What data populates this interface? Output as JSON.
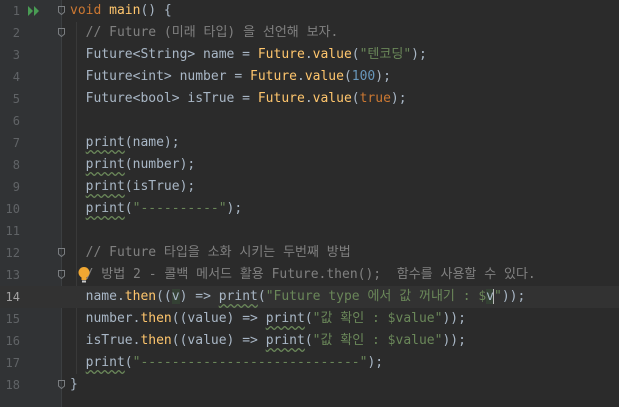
{
  "editor": {
    "lines": [
      {
        "n": "1",
        "tokens": [
          {
            "t": "void",
            "c": "kw"
          },
          {
            "t": " "
          },
          {
            "t": "main",
            "c": "fn"
          },
          {
            "t": "() {"
          }
        ]
      },
      {
        "n": "2",
        "tokens": [
          {
            "t": "  "
          },
          {
            "t": "// Future (미래 타입) 을 선언해 보자.",
            "c": "cmt"
          }
        ]
      },
      {
        "n": "3",
        "tokens": [
          {
            "t": "  Future<String> name = "
          },
          {
            "t": "Future",
            "c": "fn"
          },
          {
            "t": "."
          },
          {
            "t": "value",
            "c": "fn"
          },
          {
            "t": "("
          },
          {
            "t": "\"텐코딩\"",
            "c": "str"
          },
          {
            "t": ");"
          }
        ]
      },
      {
        "n": "4",
        "tokens": [
          {
            "t": "  Future<int> number = "
          },
          {
            "t": "Future",
            "c": "fn"
          },
          {
            "t": "."
          },
          {
            "t": "value",
            "c": "fn"
          },
          {
            "t": "("
          },
          {
            "t": "100",
            "c": "num"
          },
          {
            "t": ");"
          }
        ]
      },
      {
        "n": "5",
        "tokens": [
          {
            "t": "  Future<bool> isTrue = "
          },
          {
            "t": "Future",
            "c": "fn"
          },
          {
            "t": "."
          },
          {
            "t": "value",
            "c": "fn"
          },
          {
            "t": "("
          },
          {
            "t": "true",
            "c": "kw"
          },
          {
            "t": ");"
          }
        ]
      },
      {
        "n": "6",
        "tokens": []
      },
      {
        "n": "7",
        "tokens": [
          {
            "t": "  "
          },
          {
            "t": "print",
            "c": "warn"
          },
          {
            "t": "(name);"
          }
        ]
      },
      {
        "n": "8",
        "tokens": [
          {
            "t": "  "
          },
          {
            "t": "print",
            "c": "warn"
          },
          {
            "t": "(number);"
          }
        ]
      },
      {
        "n": "9",
        "tokens": [
          {
            "t": "  "
          },
          {
            "t": "print",
            "c": "warn"
          },
          {
            "t": "(isTrue);"
          }
        ]
      },
      {
        "n": "10",
        "tokens": [
          {
            "t": "  "
          },
          {
            "t": "print",
            "c": "warn"
          },
          {
            "t": "("
          },
          {
            "t": "\"----------\"",
            "c": "str"
          },
          {
            "t": ");"
          }
        ]
      },
      {
        "n": "11",
        "tokens": []
      },
      {
        "n": "12",
        "tokens": [
          {
            "t": "  "
          },
          {
            "t": "// Future 타입을 소화 시키는 두번째 방법",
            "c": "cmt"
          }
        ]
      },
      {
        "n": "13",
        "tokens": [
          {
            "t": "  "
          },
          {
            "t": "/ 방법 2 - 콜백 메서드 활용 Future.then();  함수를 사용할 수 있다.",
            "c": "cmt"
          }
        ]
      },
      {
        "n": "14",
        "tokens": [
          {
            "t": "  name."
          },
          {
            "t": "then",
            "c": "fn"
          },
          {
            "t": "(("
          },
          {
            "t": "v",
            "c": "hl"
          },
          {
            "t": ") => "
          },
          {
            "t": "print",
            "c": "warn"
          },
          {
            "t": "("
          },
          {
            "t": "\"Future type 에서 값 꺼내기 : $",
            "c": "str"
          },
          {
            "t": "v",
            "c": "hl"
          },
          {
            "t": "\"",
            "c": "str"
          },
          {
            "t": "));"
          }
        ]
      },
      {
        "n": "15",
        "tokens": [
          {
            "t": "  number."
          },
          {
            "t": "then",
            "c": "fn"
          },
          {
            "t": "((value) => "
          },
          {
            "t": "print",
            "c": "warn"
          },
          {
            "t": "("
          },
          {
            "t": "\"값 확인 : $value\"",
            "c": "str"
          },
          {
            "t": "));"
          }
        ]
      },
      {
        "n": "16",
        "tokens": [
          {
            "t": "  isTrue."
          },
          {
            "t": "then",
            "c": "fn"
          },
          {
            "t": "((value) => "
          },
          {
            "t": "print",
            "c": "warn"
          },
          {
            "t": "("
          },
          {
            "t": "\"값 확인 : $value\"",
            "c": "str"
          },
          {
            "t": "));"
          }
        ]
      },
      {
        "n": "17",
        "tokens": [
          {
            "t": "  "
          },
          {
            "t": "print",
            "c": "warn"
          },
          {
            "t": "("
          },
          {
            "t": "\"----------------------------\"",
            "c": "str"
          },
          {
            "t": ");"
          }
        ]
      },
      {
        "n": "18",
        "tokens": [
          {
            "t": "}"
          }
        ]
      }
    ],
    "current_line": "14",
    "run_icon": "run-gutter-icon",
    "bulb_icon": "lightbulb-icon",
    "colors": {
      "background": "#2b2b2b",
      "keyword": "#cc7832",
      "function": "#ffc66d",
      "string": "#6a8759",
      "number": "#6897bb",
      "comment": "#808080"
    }
  }
}
